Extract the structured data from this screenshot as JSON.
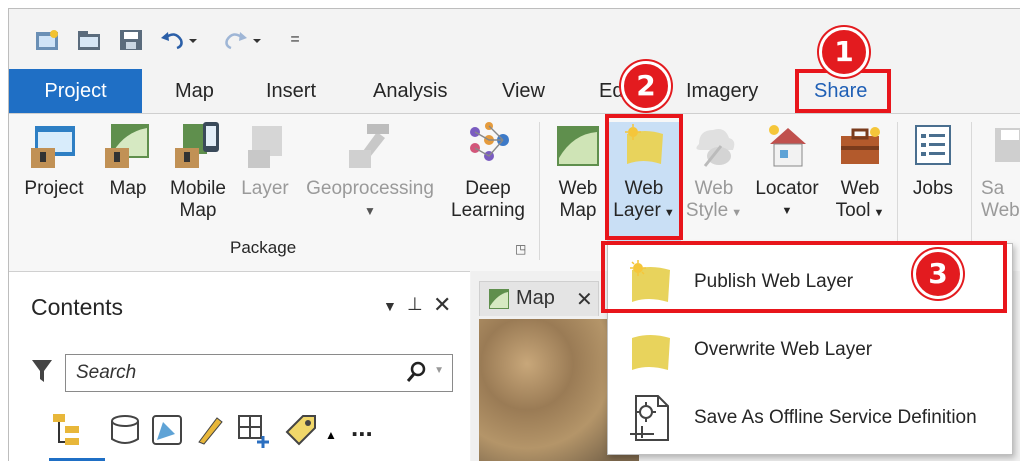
{
  "quick_access": {
    "icons": [
      "new-project-icon",
      "open-project-icon",
      "save-project-icon",
      "undo-icon",
      "redo-icon",
      "customize-icon"
    ],
    "customize_glyph": "="
  },
  "tabs": [
    {
      "label": "Project"
    },
    {
      "label": "Map"
    },
    {
      "label": "Insert"
    },
    {
      "label": "Analysis"
    },
    {
      "label": "View"
    },
    {
      "label": "Ed"
    },
    {
      "label": "Imagery"
    },
    {
      "label": "Share"
    }
  ],
  "ribbon": {
    "package": {
      "project": "Project",
      "map": "Map",
      "mobile_map_1": "Mobile",
      "mobile_map_2": "Map",
      "layer": "Layer",
      "geoprocessing": "Geoprocessing",
      "deep_learning_1": "Deep",
      "deep_learning_2": "Learning",
      "group_label": "Package"
    },
    "share_as": {
      "web_map_1": "Web",
      "web_map_2": "Map",
      "web_layer_1": "Web",
      "web_layer_2": "Layer",
      "web_style_1": "Web",
      "web_style_2": "Style",
      "locator_1": "Locator",
      "web_tool_1": "Web",
      "web_tool_2": "Tool",
      "jobs": "Jobs",
      "save_1": "Sa",
      "save_2": "Web"
    }
  },
  "contents": {
    "title": "Contents",
    "search_placeholder": "Search",
    "more": "..."
  },
  "map_view": {
    "tab_label": "Map"
  },
  "dropdown": {
    "items": [
      {
        "label": "Publish Web Layer"
      },
      {
        "label": "Overwrite Web Layer"
      },
      {
        "label": "Save As Offline Service Definition"
      }
    ]
  },
  "annotations": {
    "step1": "1",
    "step2": "2",
    "step3": "3",
    "highlight_color": "#e8151b"
  },
  "colors": {
    "accent": "#1f6fc5",
    "web_layer_fill": "#e8d35c"
  }
}
